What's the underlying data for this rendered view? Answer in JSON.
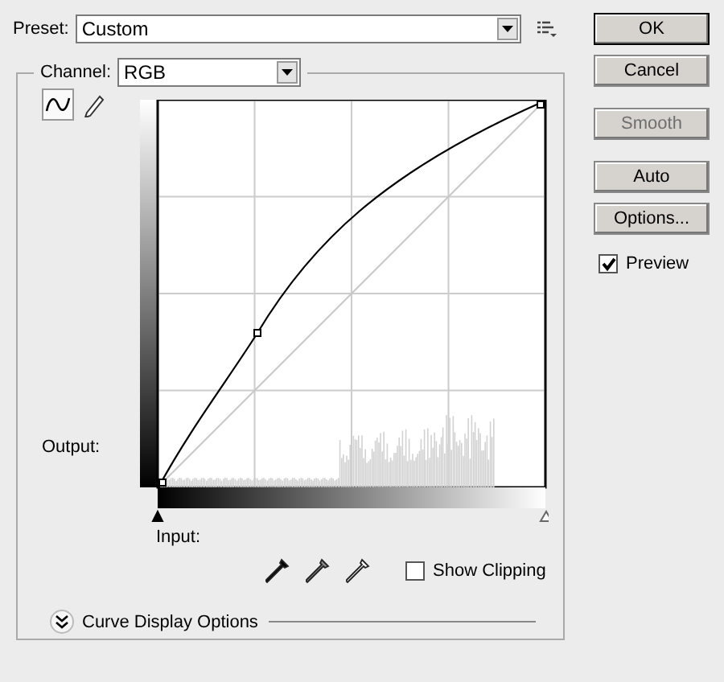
{
  "preset": {
    "label": "Preset:",
    "value": "Custom"
  },
  "channel": {
    "label": "Channel:",
    "value": "RGB"
  },
  "tools": [
    {
      "kind": "curve",
      "selected": true
    },
    {
      "kind": "pencil",
      "selected": false
    }
  ],
  "output_label": "Output:",
  "input_label": "Input:",
  "show_clipping": {
    "label": "Show Clipping",
    "checked": false
  },
  "display_options": {
    "label": "Curve Display Options",
    "expanded": false
  },
  "buttons": [
    {
      "label": "OK",
      "default": true,
      "disabled": false
    },
    {
      "label": "Cancel",
      "default": false,
      "disabled": false
    },
    {
      "label": "Smooth",
      "default": false,
      "disabled": true
    },
    {
      "label": "Auto",
      "default": false,
      "disabled": false
    },
    {
      "label": "Options...",
      "default": false,
      "disabled": false
    }
  ],
  "preview": {
    "label": "Preview",
    "checked": true
  }
}
